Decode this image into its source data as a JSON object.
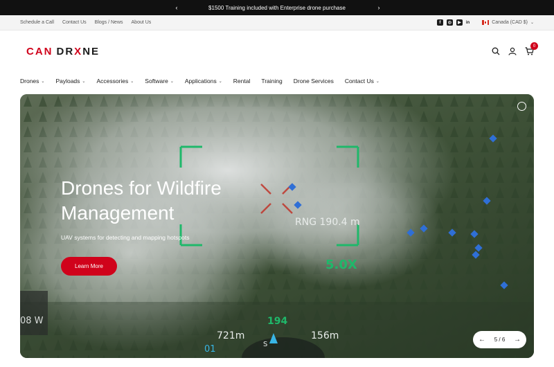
{
  "announcement": {
    "text": "$1500 Training included with Enterprise drone purchase"
  },
  "utility": {
    "links": [
      "Schedule a Call",
      "Contact Us",
      "Blogs / News",
      "About Us"
    ],
    "country": "Canada (CAD $)"
  },
  "logo": {
    "left": "CAN",
    "mid": "DR",
    "x": "X",
    "right": "NE"
  },
  "cart": {
    "count": "0"
  },
  "nav": [
    {
      "label": "Drones",
      "chevron": true
    },
    {
      "label": "Payloads",
      "chevron": true
    },
    {
      "label": "Accessories",
      "chevron": true
    },
    {
      "label": "Software",
      "chevron": true
    },
    {
      "label": "Applications",
      "chevron": true
    },
    {
      "label": "Rental",
      "chevron": false
    },
    {
      "label": "Training",
      "chevron": false
    },
    {
      "label": "Drone Services",
      "chevron": false
    },
    {
      "label": "Contact Us",
      "chevron": true
    }
  ],
  "hero": {
    "title": "Drones for Wildfire Management",
    "subtitle": "UAV systems for detecting and mapping hotspots",
    "cta": "Learn More",
    "hud": {
      "range": "RNG 190.4 m",
      "zoom": "5.0X",
      "heading": "194",
      "alt_left": "721m",
      "alt_right": "156m",
      "power": "08 W",
      "speed": "01",
      "compass": "S"
    },
    "pager": "5 / 6"
  },
  "colors": {
    "accent": "#d0021b",
    "hud_green": "#1fb86a"
  }
}
